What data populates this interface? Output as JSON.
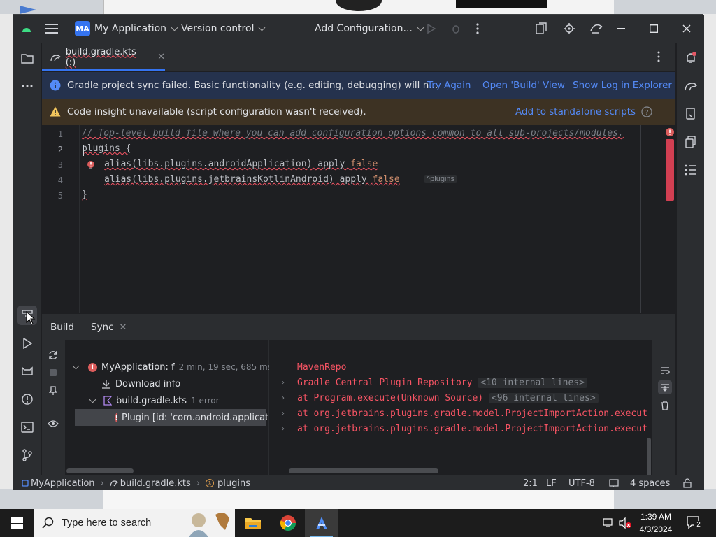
{
  "window": {
    "project_badge": "MA",
    "project_name": "My Application",
    "vcs_label": "Version control",
    "run_config": "Add Configuration..."
  },
  "editor_tab": {
    "label": "build.gradle.kts (:)"
  },
  "sync_banner": {
    "message": "Gradle project sync failed. Basic functionality (e.g. editing, debugging) will n...",
    "action_try_again": "Try Again",
    "action_open_build": "Open 'Build' View",
    "action_show_log": "Show Log in Explorer"
  },
  "warning_banner": {
    "message": "Code insight unavailable (script configuration wasn't received).",
    "action": "Add to standalone scripts"
  },
  "code": {
    "line_numbers": [
      "1",
      "2",
      "3",
      "4",
      "5"
    ],
    "line1": "// Top-level build file where you can add configuration options common to all sub-projects/modules.",
    "line2": "plugins {",
    "line3_call": "alias(libs.plugins.androidApplication) apply ",
    "line3_kw": "false",
    "line4_call": "alias(libs.plugins.jetbrainsKotlinAndroid) apply ",
    "line4_kw": "false",
    "line4_hint": "^plugins",
    "line5": "}"
  },
  "build_panel": {
    "tab_build": "Build",
    "tab_sync": "Sync",
    "tree": {
      "root_label": "MyApplication: f",
      "root_meta": "2 min, 19 sec, 685 ms",
      "download_info": "Download info",
      "build_file": "build.gradle.kts",
      "build_file_meta": "1 error",
      "error_item": "Plugin [id: 'com.android.applicat"
    },
    "console": {
      "line1": "MavenRepo",
      "line2": "Gradle Central Plugin Repository",
      "line2_fold": "<10 internal lines>",
      "line3": "at Program.execute(Unknown Source)",
      "line3_fold": "<96 internal lines>",
      "line4": "at org.jetbrains.plugins.gradle.model.ProjectImportAction.execut",
      "line5": "at org.jetbrains.plugins.gradle.model.ProjectImportAction.execut"
    }
  },
  "status_bar": {
    "crumb1": "MyApplication",
    "crumb2": "build.gradle.kts",
    "crumb3": "plugins",
    "position": "2:1",
    "line_sep": "LF",
    "encoding": "UTF-8",
    "indent": "4 spaces"
  },
  "taskbar": {
    "search_placeholder": "Type here to search",
    "time": "1:39 AM",
    "date": "4/3/2024",
    "notifications": "2"
  },
  "colors": {
    "accent": "#3574f0",
    "error": "#f75464",
    "link": "#548af7",
    "warning_bg": "#3d3223",
    "info_bg": "#25324d"
  }
}
